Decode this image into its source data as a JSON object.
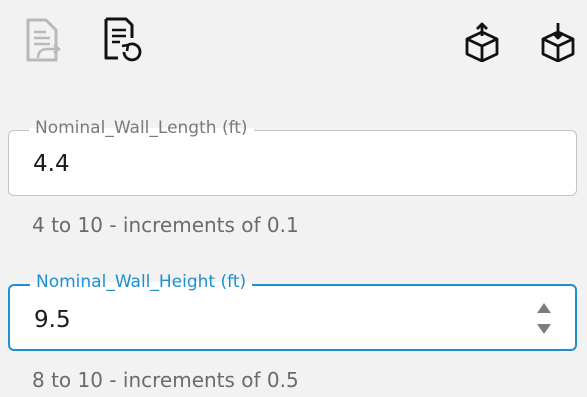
{
  "toolbar": {
    "icons": [
      {
        "name": "document-export-icon",
        "state": "disabled"
      },
      {
        "name": "document-refresh-icon",
        "state": "enabled"
      },
      {
        "name": "cube-upload-icon",
        "state": "enabled"
      },
      {
        "name": "cube-download-icon",
        "state": "enabled"
      }
    ]
  },
  "fields": {
    "length": {
      "label": "Nominal_Wall_Length (ft)",
      "value": "4.4",
      "helper": "4 to 10 - increments of 0.1",
      "focused": false
    },
    "height": {
      "label": "Nominal_Wall_Height (ft)",
      "value": "9.5",
      "helper": "8 to 10 - increments of 0.5",
      "focused": true
    }
  },
  "colors": {
    "background": "#f2f2f2",
    "focus_accent": "#1e8fcf",
    "label_idle": "#7a7a7a",
    "helper_text": "#6b6b6b",
    "disabled_icon": "#b9b9b9"
  }
}
